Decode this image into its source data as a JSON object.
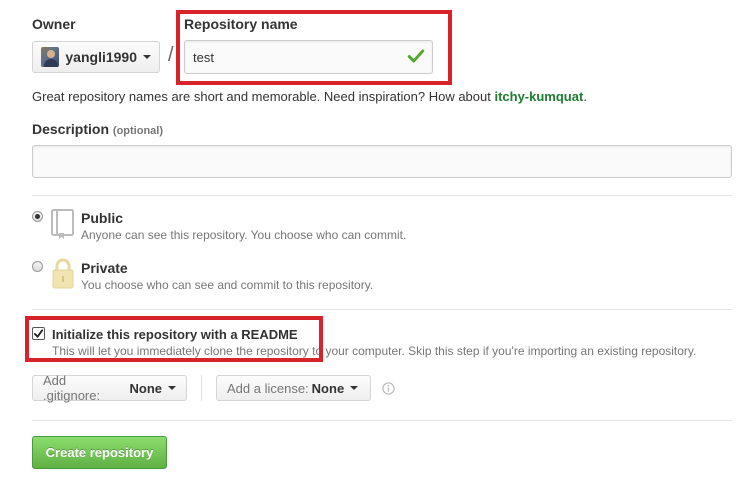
{
  "owner": {
    "label": "Owner",
    "username": "yangli1990"
  },
  "separator": "/",
  "repository": {
    "label": "Repository name",
    "value": "test"
  },
  "name_hint": {
    "text": "Great repository names are short and memorable. Need inspiration? How about ",
    "suggestion": "itchy-kumquat",
    "suffix": "."
  },
  "description": {
    "label": "Description",
    "optional": "(optional)",
    "value": ""
  },
  "visibility": {
    "selected": "Public",
    "options": [
      {
        "title": "Public",
        "desc": "Anyone can see this repository. You choose who can commit."
      },
      {
        "title": "Private",
        "desc": "You choose who can see and commit to this repository."
      }
    ]
  },
  "readme": {
    "checked": true,
    "title": "Initialize this repository with a README",
    "desc": "This will let you immediately clone the repository to your computer. Skip this step if you're importing an existing repository."
  },
  "gitignore": {
    "label": "Add .gitignore:",
    "value": "None"
  },
  "license": {
    "label": "Add a license:",
    "value": "None"
  },
  "create_button": "Create repository",
  "colors": {
    "annotation_box": "#d8232a",
    "create_button": "#60b044",
    "suggestion_link": "#1e7c2f",
    "valid_check": "#55a532"
  },
  "icons": [
    "chevron-down-icon",
    "check-icon",
    "book-icon",
    "lock-icon",
    "info-icon"
  ]
}
